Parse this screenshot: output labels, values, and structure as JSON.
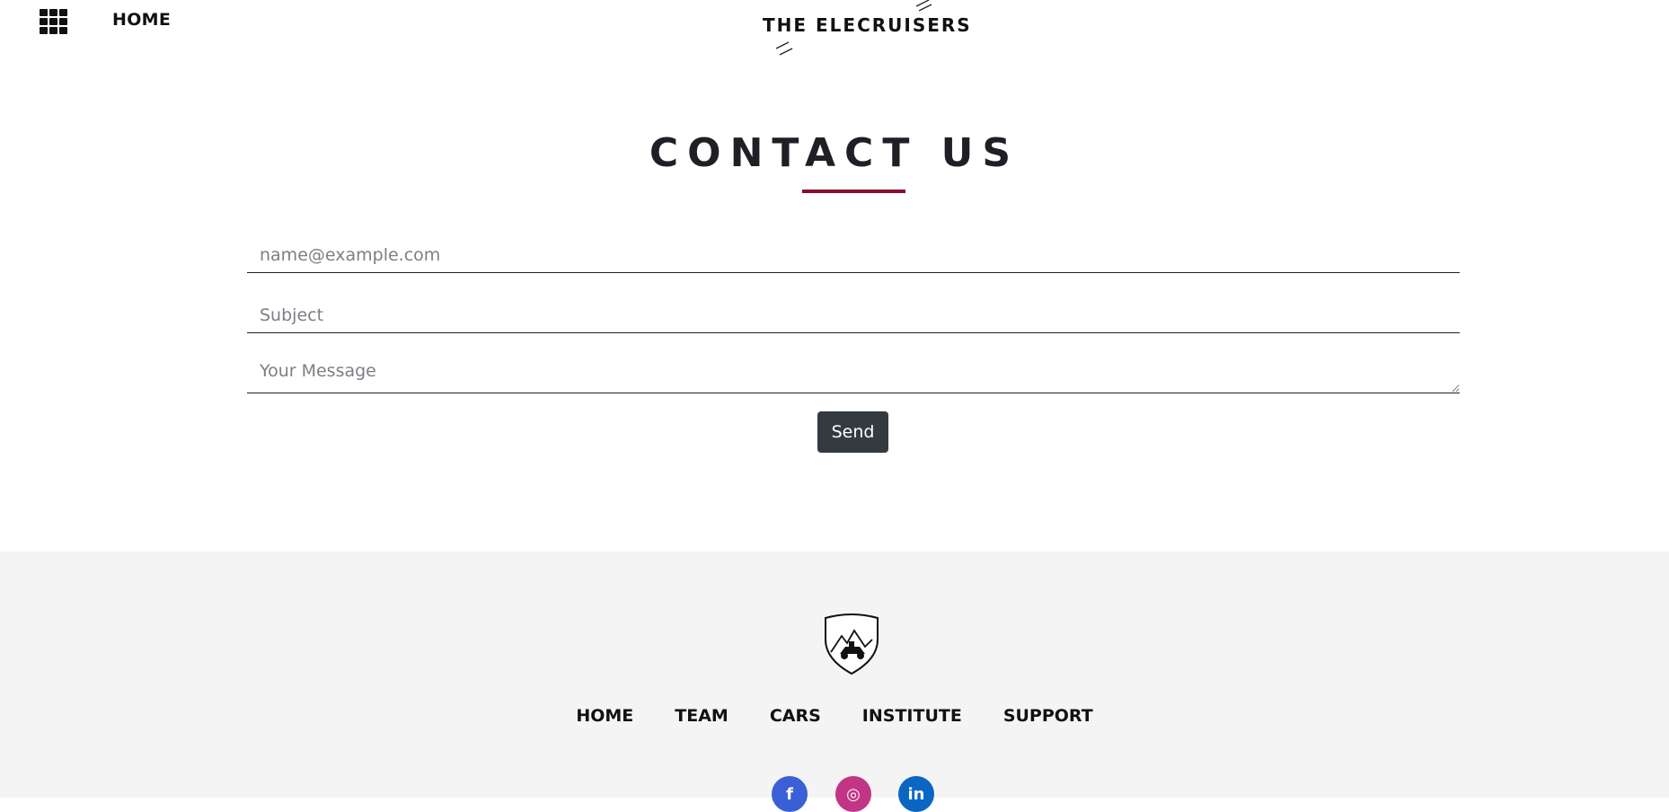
{
  "header": {
    "nav_home": "HOME",
    "brand": "THE ELECRUISERS"
  },
  "contact": {
    "title": "CONTACT US",
    "email_placeholder": "name@example.com",
    "subject_placeholder": "Subject",
    "message_placeholder": "Your Message",
    "send_label": "Send",
    "accent_color": "#8a0e2c"
  },
  "footer": {
    "nav": [
      "HOME",
      "TEAM",
      "CARS",
      "INSTITUTE",
      "SUPPORT"
    ],
    "social": {
      "facebook_glyph": "f",
      "instagram_glyph": "◎",
      "linkedin_glyph": "in"
    }
  },
  "icons": [
    "apps-grid-icon",
    "shield-logo-icon",
    "facebook-icon",
    "instagram-icon",
    "linkedin-icon"
  ]
}
